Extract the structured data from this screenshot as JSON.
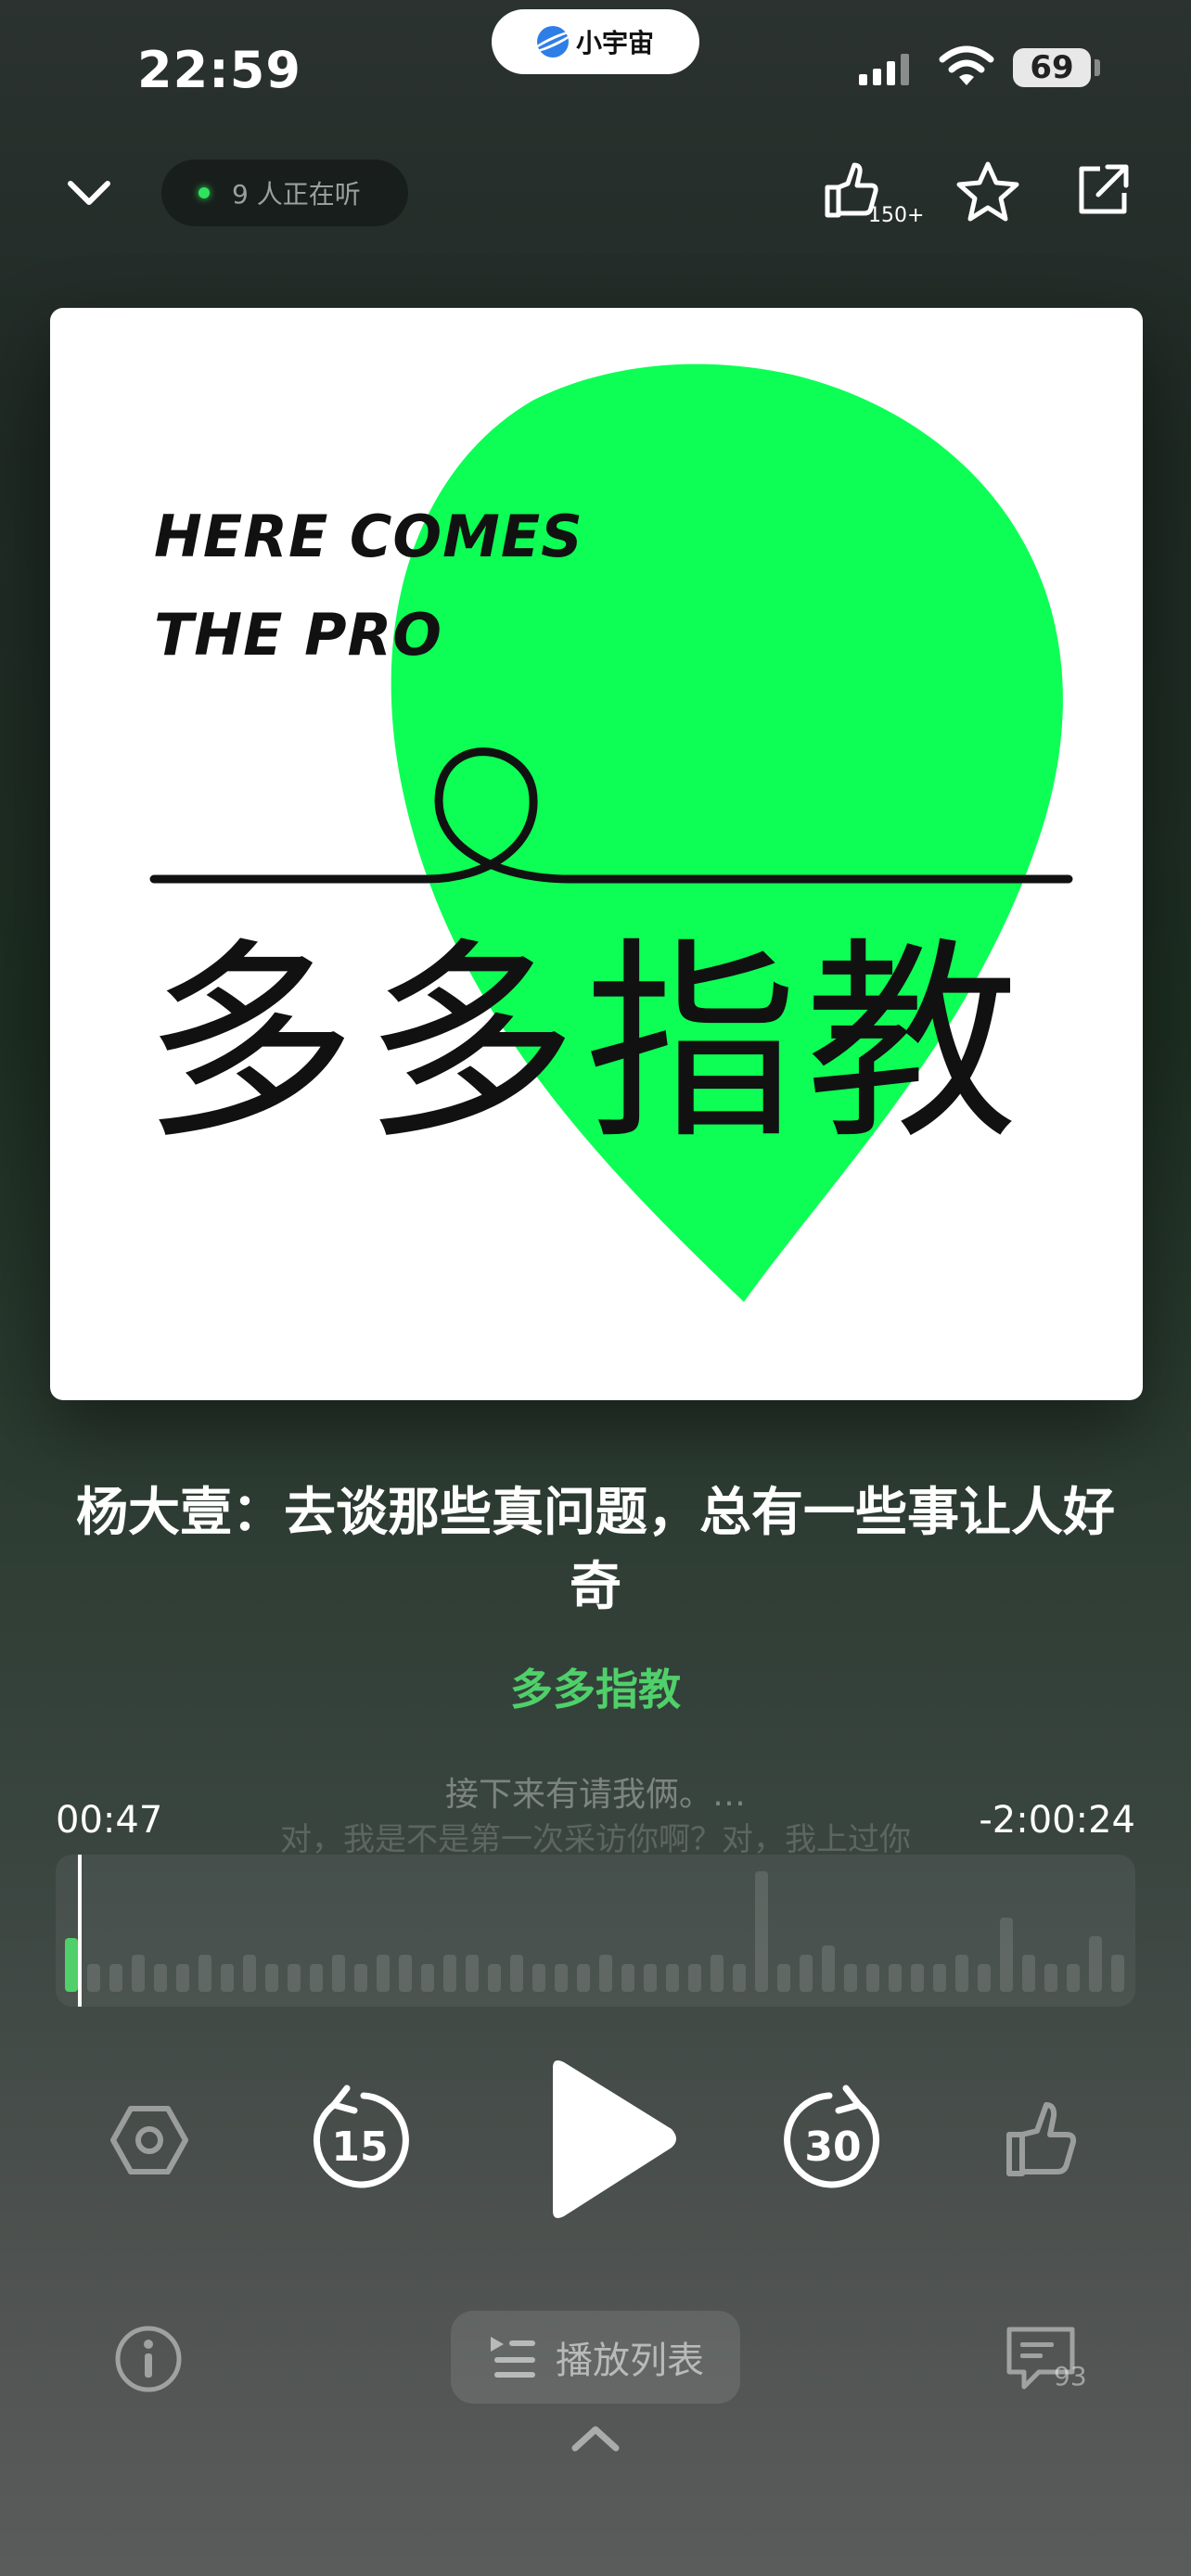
{
  "status_bar": {
    "time": "22:59",
    "app_pill": "小宇宙",
    "battery": "69"
  },
  "top": {
    "listeners": "9 人正在听",
    "like_count": "150+"
  },
  "cover": {
    "line1": "HERE COMES",
    "line2": "THE PRO",
    "big_title": "多多指教"
  },
  "episode": {
    "title": "杨大壹：去谈那些真问题，总有一些事让人好奇",
    "channel": "多多指教"
  },
  "transcript": {
    "line1": "接下来有请我俩。…",
    "line2": "对，我是不是第一次采访你啊？对，我上过你"
  },
  "progress": {
    "elapsed": "00:47",
    "remaining": "-2:00:24",
    "fraction": 0.006
  },
  "controls": {
    "rewind": "15",
    "forward": "30"
  },
  "bottom": {
    "playlist_label": "播放列表",
    "comment_count": "93"
  },
  "colors": {
    "accent": "#4fd06a",
    "cover_green": "#0dff55"
  }
}
